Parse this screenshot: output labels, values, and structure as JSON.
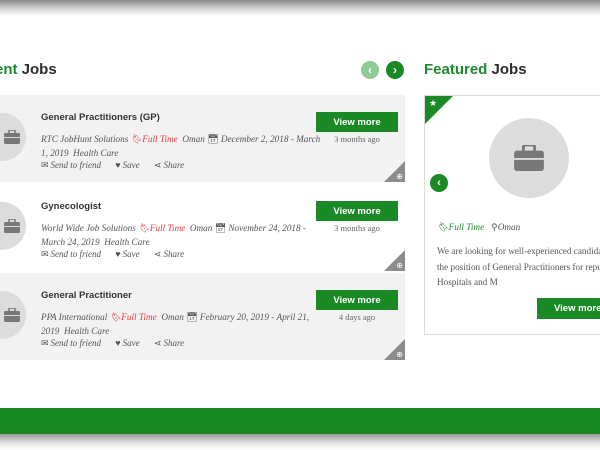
{
  "recent": {
    "title_accent": "ent",
    "title_rest": " Jobs",
    "prev_icon": "chevron-left-icon",
    "next_icon": "chevron-right-icon"
  },
  "featured": {
    "title_accent": "Featured",
    "title_rest": " Jobs",
    "type": "Full Time",
    "location": "Oman",
    "description": "We are looking for well-experienced candidates for the position of General Practitioners for reputed Hospitals and M",
    "button": "View more"
  },
  "actions": {
    "send": "Send to friend",
    "save": "Save",
    "share": "Share"
  },
  "jobs": [
    {
      "title": "General Practitioners (GP)",
      "company": "RTC JobHunt Solutions",
      "type": "Full Time",
      "location": "Oman",
      "dates_line1": "December 2, 2018 - March",
      "dates_line2": "1, 2019",
      "category": "Health Care",
      "button": "View more",
      "ago": "3 months ago"
    },
    {
      "title": "Gynecologist",
      "company": "World Wide Job Solutions",
      "type": "Full Time",
      "location": "Oman",
      "dates_line1": "November 24, 2018 -",
      "dates_line2": "March 24, 2019",
      "category": "Health Care",
      "button": "View more",
      "ago": "3 months ago"
    },
    {
      "title": "General Practitioner",
      "company": "PPA International",
      "type": "Full Time",
      "location": "Oman",
      "dates_line1": "February 20, 2019 - April 21,",
      "dates_line2": "2019",
      "category": "Health Care",
      "button": "View more",
      "ago": "4 days ago"
    }
  ],
  "colors": {
    "accent": "#1b8a26",
    "fulltime": "#e23b3b",
    "row": "#f2f2f2"
  }
}
